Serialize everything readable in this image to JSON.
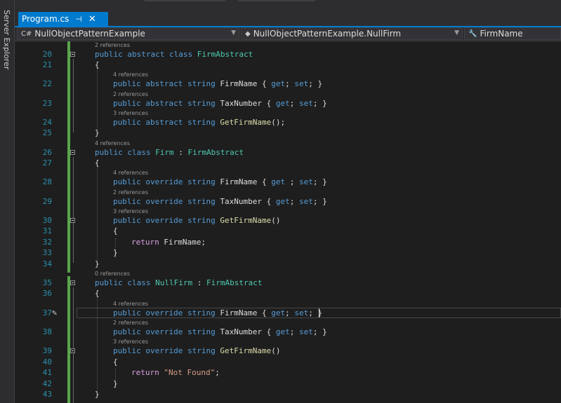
{
  "sidebar": {
    "server_explorer": "Server Explorer"
  },
  "tab": {
    "label": "Program.cs",
    "pin_glyph": "⊣",
    "close_glyph": "✕"
  },
  "navbar": {
    "project": {
      "icon": "csharp-project-icon",
      "label": "NullObjectPatternExample"
    },
    "type": {
      "icon": "class-icon",
      "label": "NullObjectPatternExample.NullFirm"
    },
    "member": {
      "icon": "wrench-property-icon",
      "label": "FirmName"
    }
  },
  "colors": {
    "keyword": "#569cd6",
    "type": "#4ec9b0",
    "method": "#dcdcaa",
    "string": "#d69d85",
    "control": "#d8a0df",
    "line_number": "#2b91af",
    "accent": "#007acc",
    "change_bar": "#57a64a"
  },
  "editor": {
    "lines": [
      {
        "num": "20",
        "ref": "2 references",
        "code": "public abstract class FirmAbstract"
      },
      {
        "num": "21",
        "code": "{"
      },
      {
        "num": "22",
        "ref": "4 references",
        "code": "public abstract string FirmName { get; set; }"
      },
      {
        "num": "23",
        "ref": "2 references",
        "code": "public abstract string TaxNumber { get; set; }"
      },
      {
        "num": "24",
        "ref": "3 references",
        "code": "public abstract string GetFirmName();"
      },
      {
        "num": "25",
        "code": "}"
      },
      {
        "num": "26",
        "ref": "4 references",
        "code": "public class Firm : FirmAbstract"
      },
      {
        "num": "27",
        "code": "{"
      },
      {
        "num": "28",
        "ref": "4 references",
        "code": "public override string FirmName { get ; set; }"
      },
      {
        "num": "29",
        "ref": "2 references",
        "code": "public override string TaxNumber { get; set; }"
      },
      {
        "num": "30",
        "ref": "3 references",
        "code": "public override string GetFirmName()"
      },
      {
        "num": "31",
        "code": "{"
      },
      {
        "num": "32",
        "code": "return FirmName;"
      },
      {
        "num": "33",
        "code": "}"
      },
      {
        "num": "34",
        "code": "}"
      },
      {
        "num": "35",
        "ref": "0 references",
        "code": "public class NullFirm : FirmAbstract"
      },
      {
        "num": "36",
        "code": "{"
      },
      {
        "num": "37",
        "ref": "4 references",
        "code": "public override string FirmName { get; set; }"
      },
      {
        "num": "38",
        "ref": "2 references",
        "code": "public override string TaxNumber { get; set; }"
      },
      {
        "num": "39",
        "ref": "3 references",
        "code": "public override string GetFirmName()"
      },
      {
        "num": "40",
        "code": "{"
      },
      {
        "num": "41",
        "code": "return \"Not Found\";"
      },
      {
        "num": "42",
        "code": "}"
      },
      {
        "num": "43",
        "code": "}"
      }
    ]
  }
}
